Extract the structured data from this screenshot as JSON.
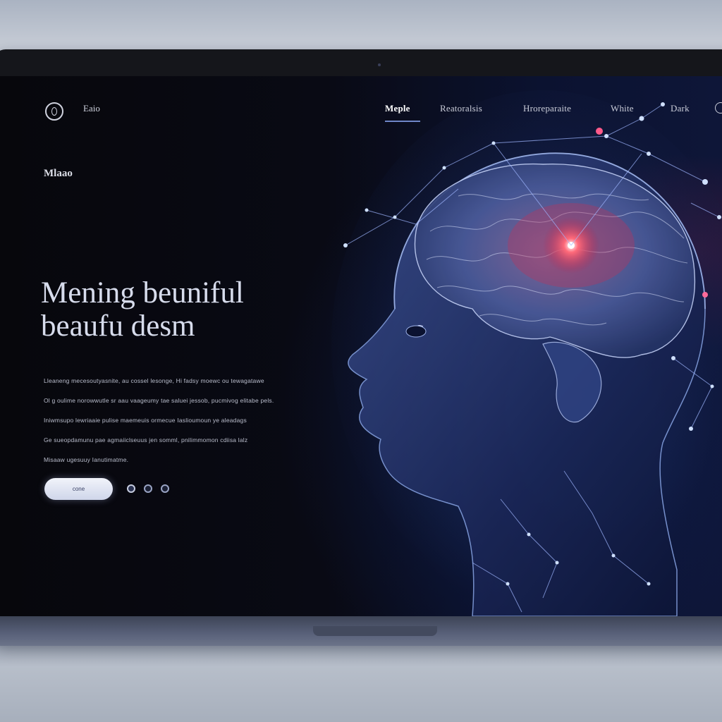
{
  "nav": {
    "brand": "Eaio",
    "items": [
      {
        "label": "Meple",
        "active": true
      },
      {
        "label": "Reatoralsis",
        "active": false
      },
      {
        "label": "Hroreparaite",
        "active": false
      },
      {
        "label": "White",
        "active": false
      },
      {
        "label": "Dark",
        "active": false
      }
    ]
  },
  "hero": {
    "section_label": "Mlaao",
    "headline_line1": "Mening beuniful",
    "headline_line2": "beaufu desm",
    "body_lines": [
      "Lleaneng mecesoutyasnite, au cossel lesonge, Hi fadsy moewc ou tewagatawe",
      "Ol g oulime norowwutle sr aau vaageumy tae saluei jessob, pucmivog elitabe pels.",
      "Iniwmsupo lewriaaie pulise maemeuis ormecue Iaslioumoun ye aleadags",
      "Ge sueopdamunu pae agmaiiclseuus jen somml, pnilimmomon cdiisa lalz",
      "Misaaw ugesuuy Ianutimatme."
    ],
    "button_label": "cone",
    "carousel": {
      "count": 3,
      "active_index": 0
    }
  },
  "colors": {
    "accent": "#6f86c8",
    "brain_highlight": "#ff3355",
    "background": "#07070c"
  }
}
